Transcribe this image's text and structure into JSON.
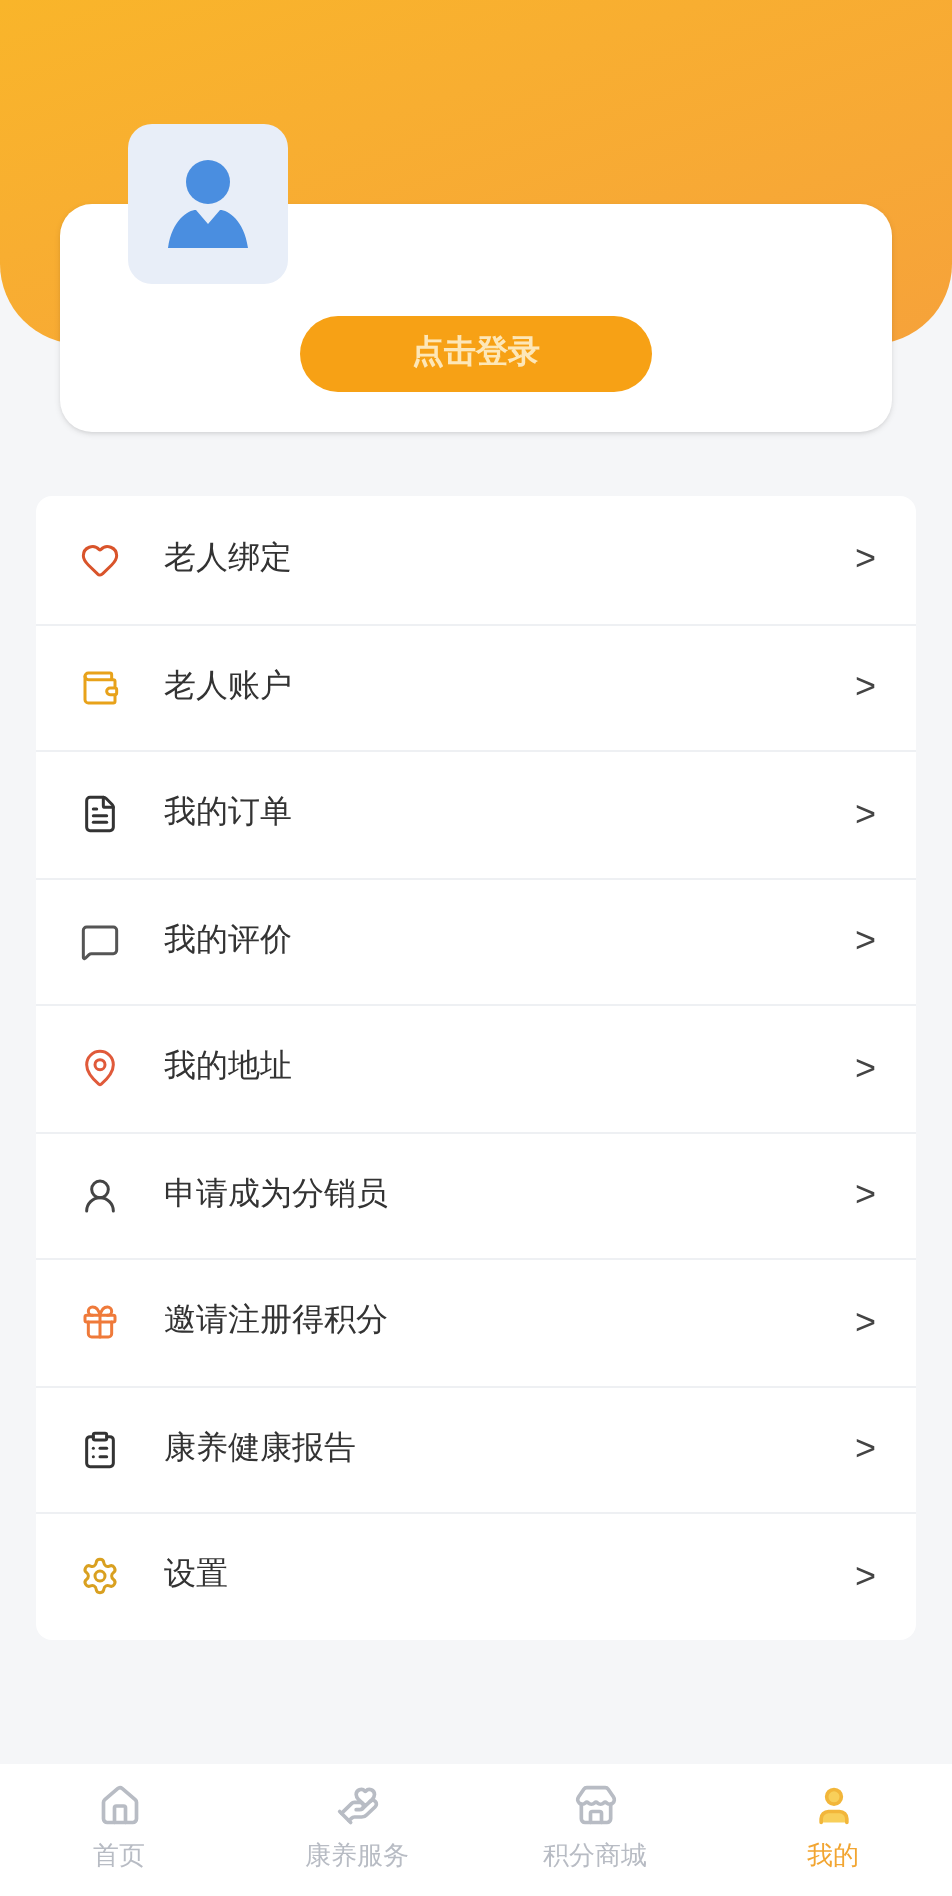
{
  "profile": {
    "login_button": "点击登录"
  },
  "menu": [
    {
      "kind": "heart",
      "label": "老人绑定",
      "chevron": ">"
    },
    {
      "kind": "account",
      "label": "老人账户",
      "chevron": ">"
    },
    {
      "kind": "order",
      "label": "我的订单",
      "chevron": ">"
    },
    {
      "kind": "review",
      "label": "我的评价",
      "chevron": ">"
    },
    {
      "kind": "address",
      "label": "我的地址",
      "chevron": ">"
    },
    {
      "kind": "person",
      "label": "申请成为分销员",
      "chevron": ">"
    },
    {
      "kind": "invite",
      "label": "邀请注册得积分",
      "chevron": ">"
    },
    {
      "kind": "report",
      "label": "康养健康报告",
      "chevron": ">"
    },
    {
      "kind": "settings",
      "label": "设置",
      "chevron": ">"
    }
  ],
  "tabs": [
    {
      "kind": "home",
      "label": "首页",
      "selected": false
    },
    {
      "kind": "service",
      "label": "康养服务",
      "selected": false
    },
    {
      "kind": "points",
      "label": "积分商城",
      "selected": false
    },
    {
      "kind": "mine",
      "label": "我的",
      "selected": true
    }
  ]
}
